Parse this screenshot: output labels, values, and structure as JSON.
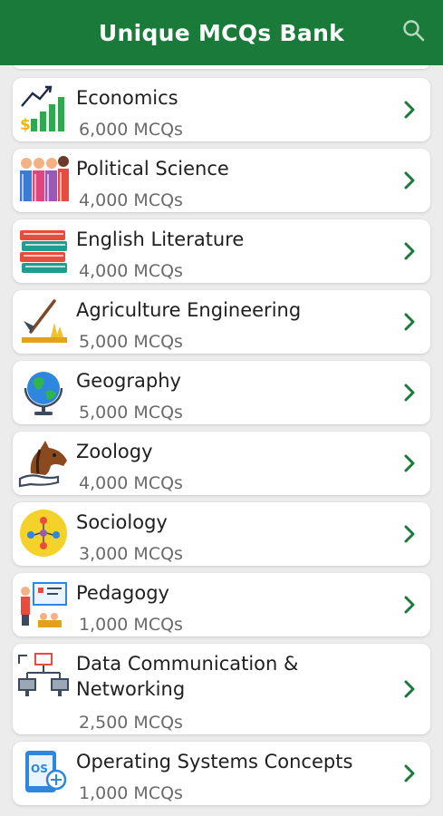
{
  "app": {
    "title": "Unique MCQs Bank",
    "search_icon": "search-icon"
  },
  "colors": {
    "appbar": "#1a7a3a",
    "chevron": "#1a7a3a",
    "background": "#ececec"
  },
  "subjects": [
    {
      "title": "Economics",
      "count": "6,000 MCQs",
      "icon": "economics-chart-icon"
    },
    {
      "title": "Political Science",
      "count": "4,000 MCQs",
      "icon": "political-science-people-icon"
    },
    {
      "title": "English Literature",
      "count": "4,000 MCQs",
      "icon": "books-stack-icon"
    },
    {
      "title": "Agriculture Engineering",
      "count": "5,000 MCQs",
      "icon": "agriculture-tool-icon"
    },
    {
      "title": "Geography",
      "count": "5,000 MCQs",
      "icon": "globe-icon"
    },
    {
      "title": "Zoology",
      "count": "4,000 MCQs",
      "icon": "horse-head-icon"
    },
    {
      "title": "Sociology",
      "count": "3,000 MCQs",
      "icon": "people-network-icon"
    },
    {
      "title": "Pedagogy",
      "count": "1,000 MCQs",
      "icon": "teacher-board-icon"
    },
    {
      "title": "Data Communication & Networking",
      "count": "2,500 MCQs",
      "icon": "computer-network-icon"
    },
    {
      "title": "Operating Systems Concepts",
      "count": "1,000 MCQs",
      "icon": "os-device-icon"
    }
  ]
}
